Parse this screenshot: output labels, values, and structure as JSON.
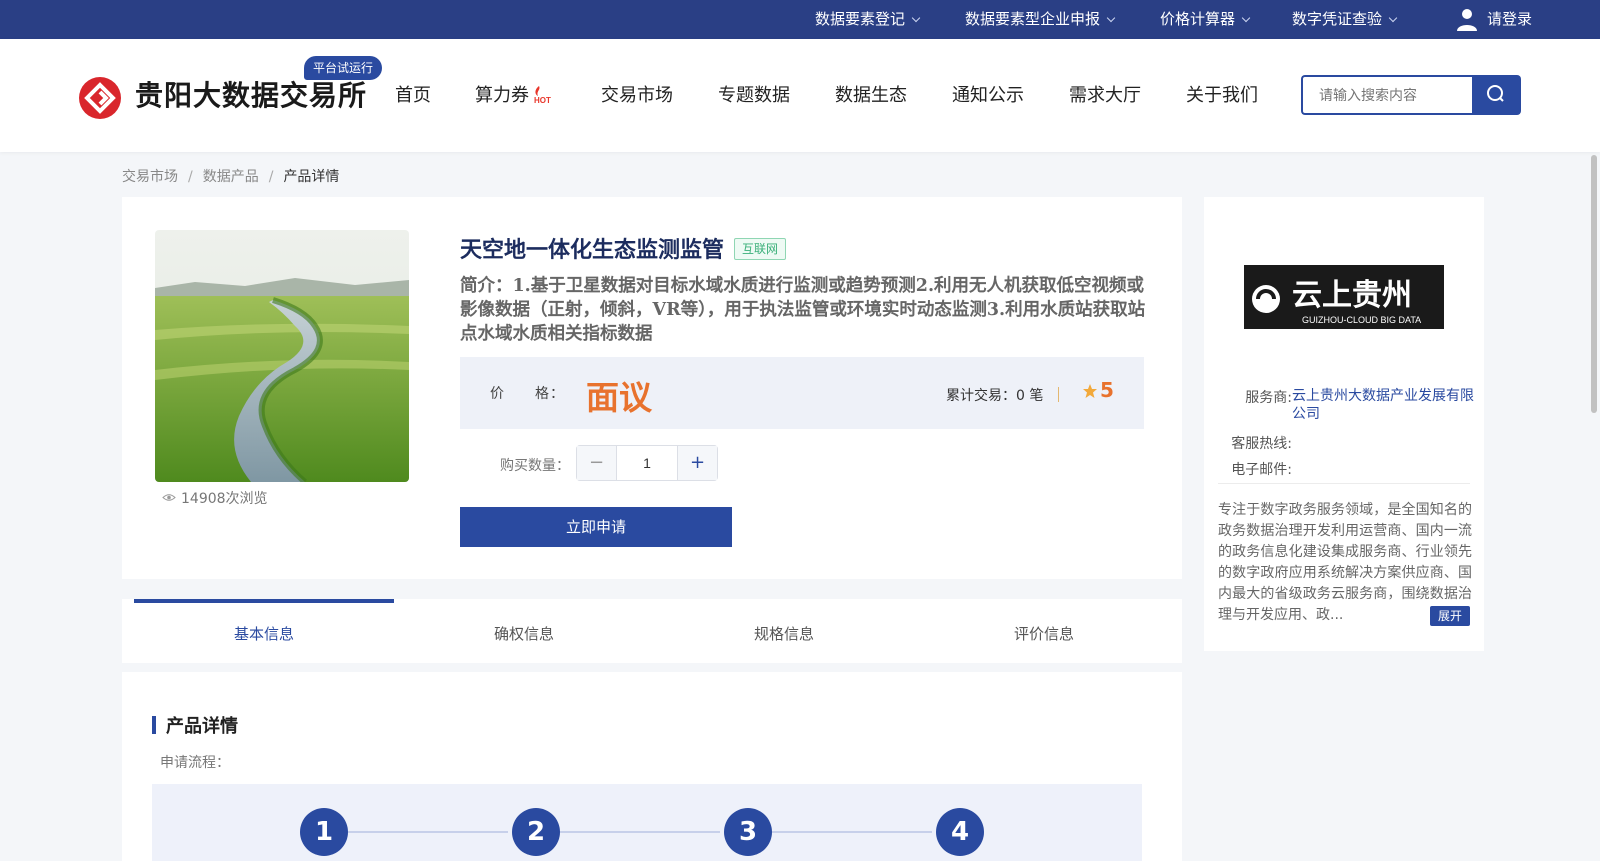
{
  "topbar": {
    "items": [
      "数据要素登记",
      "数据要素型企业申报",
      "价格计算器",
      "数字凭证查验"
    ],
    "login": "请登录"
  },
  "header": {
    "logo_text": "贵阳大数据交易所",
    "trial_badge": "平台试运行",
    "nav": [
      "首页",
      "算力券",
      "交易市场",
      "专题数据",
      "数据生态",
      "通知公示",
      "需求大厅",
      "关于我们"
    ],
    "hot_icon": "hot-flame-icon",
    "search_placeholder": "请输入搜索内容"
  },
  "breadcrumb": {
    "items": [
      "交易市场",
      "数据产品",
      "产品详情"
    ],
    "separator": "/"
  },
  "product": {
    "title": "天空地一体化生态监测监管",
    "tag": "互联网",
    "intro": "简介：1.基于卫星数据对目标水域水质进行监测或趋势预测2.利用无人机获取低空视频或影像数据（正射，倾斜，VR等），用于执法监管或环境实时动态监测3.利用水质站获取站点水域水质相关指标数据",
    "price_label": "价　　格：",
    "price_value": "面议",
    "trade_count": "累计交易：0 笔",
    "divider": "|",
    "rating": "5",
    "views": "14908次浏览",
    "qty_label": "购买数量：",
    "qty_value": "1",
    "minus": "−",
    "plus": "+",
    "apply_button": "立即申请"
  },
  "tabs": [
    "基本信息",
    "确权信息",
    "规格信息",
    "评价信息"
  ],
  "details": {
    "section_title": "产品详情",
    "flow_label": "申请流程：",
    "steps": [
      "1",
      "2",
      "3",
      "4"
    ]
  },
  "provider": {
    "logo_cn": "云上贵州",
    "logo_en": "GUIZHOU-CLOUD BIG DATA",
    "service_label": "服务商:",
    "service_value": "云上贵州大数据产业发展有限公司",
    "hotline_label": "客服热线:",
    "email_label": "电子邮件:",
    "description": "专注于数字政务服务领域，是全国知名的政务数据治理开发利用运营商、国内一流的政务信息化建设集成服务商、行业领先的数字政府应用系统解决方案供应商、国内最大的省级政务云服务商，围绕数据治理与开发应用、政...",
    "expand": "展开"
  },
  "colors": {
    "brand": "#2a4aa0",
    "topbar": "#2a3f85",
    "price": "#e8722d",
    "tag_green": "#3bb07a"
  }
}
